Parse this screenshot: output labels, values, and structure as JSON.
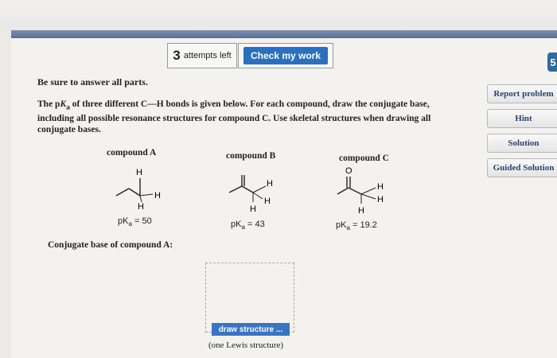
{
  "toolbar": {
    "attempts_count": "3",
    "attempts_text": "attempts left",
    "check_label": "Check my work",
    "side_tab": "5"
  },
  "sidebar": {
    "report": "Report problem",
    "hint": "Hint",
    "solution": "Solution",
    "guided": "Guided Solution"
  },
  "content": {
    "instruction": "Be sure to answer all parts.",
    "question_intro": "The p",
    "question_k": "K",
    "question_a": "a",
    "question_rest": " of three different C—H bonds is given below. For each compound, draw the conjugate base, including all possible resonance structures for compound C. Use skeletal structures when drawing all conjugate bases."
  },
  "compounds": [
    {
      "label": "compound A",
      "pka_prefix": "pK",
      "pka_sub": "a",
      "pka_value": " = 50",
      "atoms": [
        "H",
        "H",
        "H"
      ]
    },
    {
      "label": "compound B",
      "pka_prefix": "pK",
      "pka_sub": "a",
      "pka_value": " = 43",
      "atoms": [
        "H",
        "H",
        "H"
      ]
    },
    {
      "label": "compound C",
      "pka_prefix": "pK",
      "pka_sub": "a",
      "pka_value": " = 19.2",
      "atoms": [
        "O",
        "H",
        "H",
        "H"
      ]
    }
  ],
  "answer": {
    "label": "Conjugate base of compound A:",
    "draw_button": "draw structure ...",
    "note": "(one Lewis structure)"
  }
}
